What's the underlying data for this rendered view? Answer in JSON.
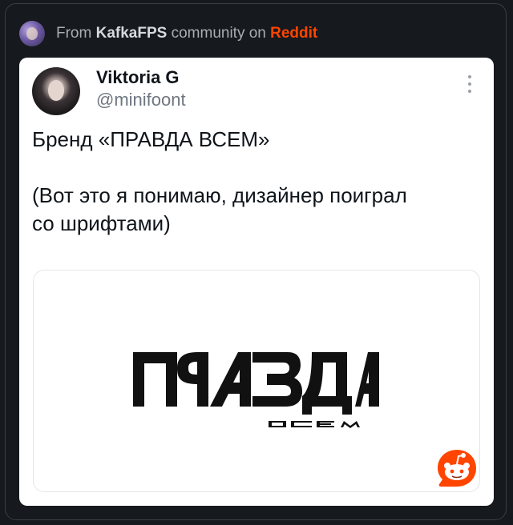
{
  "header": {
    "prefix": "From ",
    "community": "KafkaFPS",
    "middle": " community on ",
    "platform": "Reddit"
  },
  "post": {
    "author_name": "Viktoria G",
    "author_handle": "@minifoont",
    "line1": "Бренд «ПРАВДА ВСЕМ»",
    "line2": "(Вот это я понимаю, дизайнер поиграл",
    "line3": "со шрифтами)"
  },
  "image": {
    "logo_text": "ПРАВДА",
    "logo_subtext": "ВСЕМ"
  },
  "colors": {
    "reddit_orange": "#ff4500",
    "background": "#16191d"
  },
  "icons": {
    "community_avatar": "avatar-icon",
    "more": "kebab-menu-icon",
    "reddit": "reddit-snoo-icon"
  }
}
